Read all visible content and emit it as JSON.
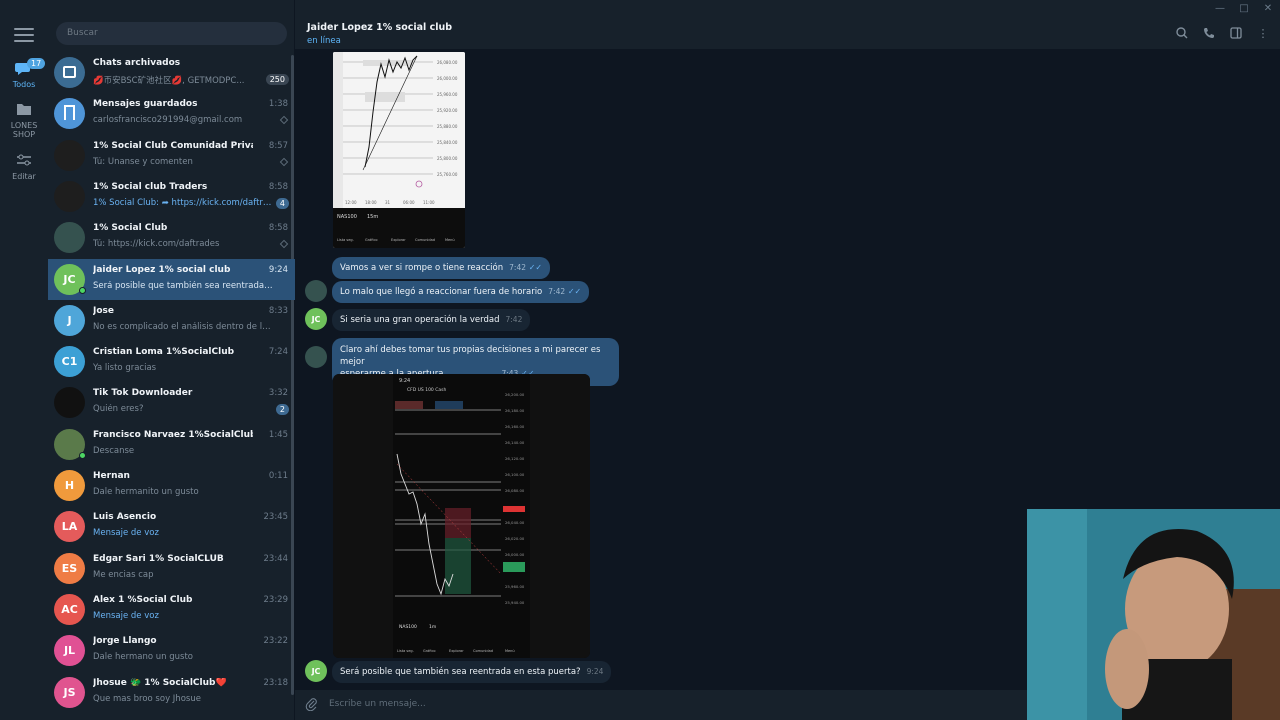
{
  "sidebar_rail": {
    "badge": "17",
    "folders": [
      {
        "label": "Todos",
        "icon": "chats-icon"
      },
      {
        "label": "LONES SHOP",
        "icon": "folder-icon"
      },
      {
        "label": "Editar",
        "icon": "sliders-icon"
      }
    ]
  },
  "chat_list": {
    "search_placeholder": "Buscar",
    "chats": [
      {
        "name": "Chats archivados",
        "preview": "💋币安BSC矿池社区💋, GETMODPC...",
        "time": "",
        "count": "250",
        "avatar_text": "",
        "avatar_color": "#3b6c93"
      },
      {
        "name": "Mensajes guardados",
        "preview": "carlosfrancisco291994@gmail.com",
        "time": "1:38",
        "count": "",
        "avatar_text": "",
        "avatar_color": "#4f95d8"
      },
      {
        "name": "1% Social Club Comunidad Privada",
        "preview": "Tú: Únanse y comenten",
        "time": "8:57",
        "count": "",
        "avatar_text": "",
        "avatar_color": "#1e1e1e"
      },
      {
        "name": "1% Social club Traders",
        "preview": "1% Social Club: ➦ https://kick.com/daftrades",
        "time": "8:58",
        "count": "4",
        "avatar_text": "",
        "avatar_color": "#1e1e1e"
      },
      {
        "name": "1% Social Club",
        "preview": "Tú: https://kick.com/daftrades",
        "time": "8:58",
        "count": "",
        "avatar_text": "",
        "avatar_color": "#35524f"
      },
      {
        "name": "Jaider Lopez 1% social club",
        "preview": "Será posible que también sea reentrada en ...",
        "time": "9:24",
        "count": "",
        "avatar_text": "JC",
        "avatar_color": "#6fc15b"
      },
      {
        "name": "Jose",
        "preview": "No es complicado el análisis dentro de la comu...",
        "time": "8:33",
        "count": "",
        "avatar_text": "J",
        "avatar_color": "#4fa6d9"
      },
      {
        "name": "Cristian Loma 1%SocialClub",
        "preview": "Ya listo gracias",
        "time": "7:24",
        "count": "",
        "avatar_text": "C1",
        "avatar_color": "#3ca0d5"
      },
      {
        "name": "Tik Tok Downloader",
        "preview": "Quién eres?",
        "time": "3:32",
        "count": "2",
        "avatar_text": "",
        "avatar_color": "#111111"
      },
      {
        "name": "Francisco Narvaez 1%SocialClub",
        "preview": "Descanse",
        "time": "1:45",
        "count": "",
        "avatar_text": "",
        "avatar_color": "#5a7a4a"
      },
      {
        "name": "Hernan",
        "preview": "Dale hermanito un gusto",
        "time": "0:11",
        "count": "",
        "avatar_text": "H",
        "avatar_color": "#f09a3c"
      },
      {
        "name": "Luis Asencio",
        "preview": "Mensaje de voz",
        "time": "23:45",
        "count": "",
        "avatar_text": "LA",
        "avatar_color": "#e45b5b"
      },
      {
        "name": "Edgar Sari 1% SocialCLUB",
        "preview": "Me encias cap",
        "time": "23:44",
        "count": "",
        "avatar_text": "ES",
        "avatar_color": "#ef7c45"
      },
      {
        "name": "Alex 1 %Social Club",
        "preview": "Mensaje de voz",
        "time": "23:29",
        "count": "",
        "avatar_text": "AC",
        "avatar_color": "#e6564f"
      },
      {
        "name": "Jorge Llango",
        "preview": "Dale hermano un gusto",
        "time": "23:22",
        "count": "",
        "avatar_text": "JL",
        "avatar_color": "#e05194"
      },
      {
        "name": "Jhosue 🐲 1% SocialClub❤️",
        "preview": "Que mas broo soy Jhosue",
        "time": "23:18",
        "count": "",
        "avatar_text": "JS",
        "avatar_color": "#e0548f"
      }
    ]
  },
  "conversation": {
    "title": "Jaider Lopez 1% social club",
    "status": "en línea",
    "messages": [
      {
        "text": "Vamos a ver si rompe o tiene reacción",
        "time": "7:42"
      },
      {
        "text": "Lo malo que llegó a reaccionar fuera de horario",
        "time": "7:42"
      },
      {
        "text": "Si seria una gran operación la verdad",
        "time": "7:42"
      },
      {
        "text": "Claro ahí debes tomar tus propias decisiones a mi parecer es mejor",
        "text2": "esperarme a la apertura",
        "time": "7:43"
      },
      {
        "text": "Será posible que también sea reentrada en esta puerta?",
        "time": "9:24"
      }
    ],
    "screenshot1": {
      "symbol": "NAS100",
      "timeframe": "15m",
      "tabs": [
        "Lista seg.",
        "Gráfico",
        "Explorar",
        "Comunidad",
        "Menú"
      ]
    },
    "screenshot2": {
      "clock": "9:24",
      "header": "CFD US 100 Cash",
      "symbol": "NAS100",
      "timeframe": "1m",
      "tabs": [
        "Lista seg.",
        "Gráfico",
        "Explorar",
        "Comunidad",
        "Menú"
      ]
    },
    "composer_placeholder": "Escribe un mensaje..."
  }
}
